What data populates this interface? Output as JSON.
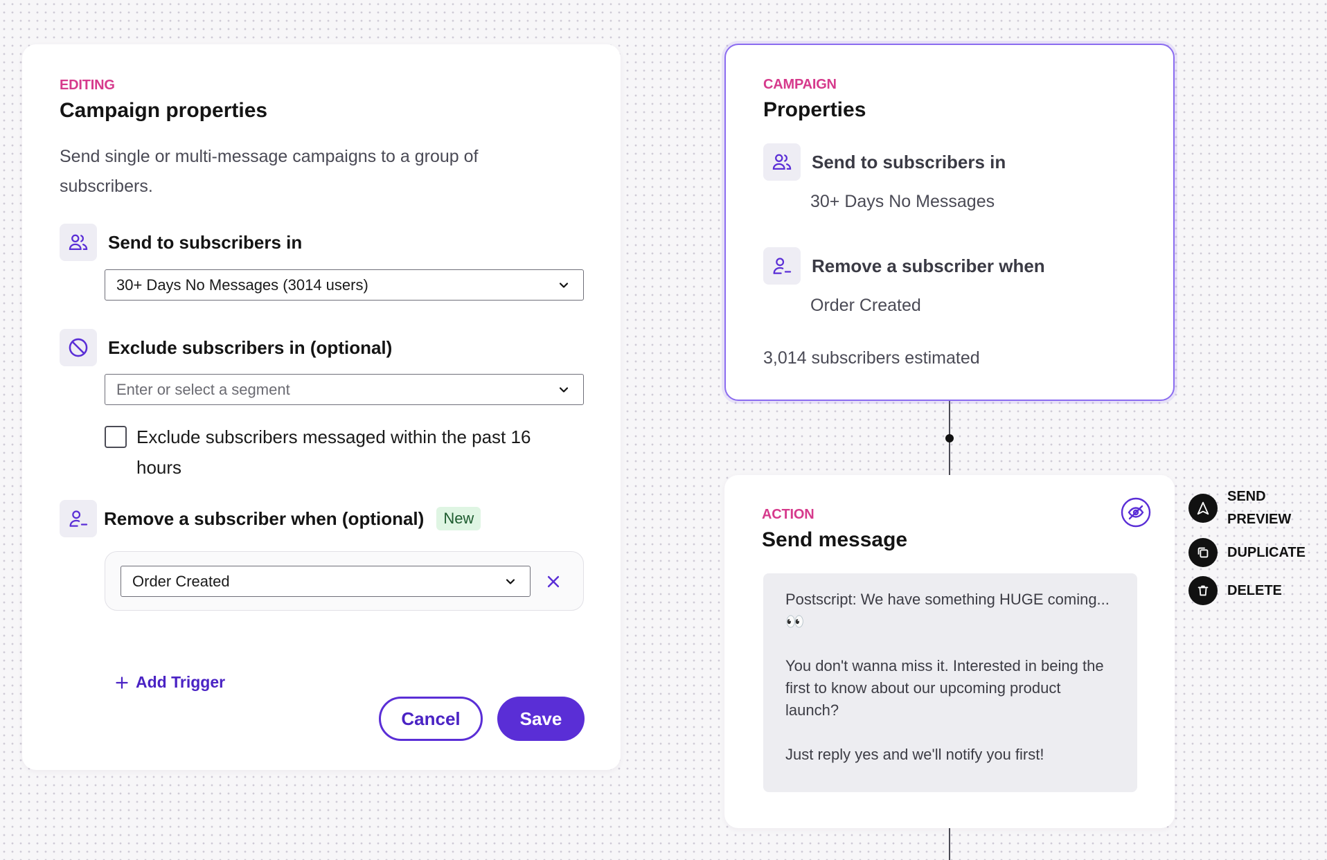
{
  "editing_panel": {
    "eyebrow": "EDITING",
    "title": "Campaign properties",
    "description": "Send single or multi-message campaigns to a group of subscribers.",
    "send_to": {
      "label": "Send to subscribers in",
      "selected": "30+ Days No Messages (3014 users)"
    },
    "exclude": {
      "label": "Exclude subscribers in (optional)",
      "placeholder": "Enter or select a segment"
    },
    "exclude_recent": {
      "label": "Exclude subscribers messaged within the past 16 hours",
      "checked": false
    },
    "remove_when": {
      "label": "Remove a subscriber when (optional)",
      "badge": "New",
      "trigger_selected": "Order Created",
      "add_trigger_label": "Add Trigger"
    },
    "cancel_label": "Cancel",
    "save_label": "Save"
  },
  "campaign_card": {
    "eyebrow": "CAMPAIGN",
    "title": "Properties",
    "send_to_label": "Send to subscribers in",
    "send_to_value": "30+ Days No Messages",
    "remove_label": "Remove a subscriber when",
    "remove_value": "Order Created",
    "estimate": "3,014 subscribers estimated"
  },
  "action_card": {
    "eyebrow": "ACTION",
    "title": "Send message",
    "message_paragraphs": [
      "Postscript: We have something HUGE coming...👀",
      "You don't wanna miss it. Interested in being the first to know about our upcoming product launch?",
      "Just reply yes and we'll notify you first!"
    ]
  },
  "side_actions": {
    "send_preview_line1": "SEND",
    "send_preview_line2": "PREVIEW",
    "duplicate": "DUPLICATE",
    "delete": "DELETE"
  },
  "colors": {
    "accent": "#5a2ed6",
    "eyebrow": "#d63a8c",
    "selected_border": "#8a6bf0",
    "new_badge_bg": "#dff5e3"
  },
  "icons": {
    "users": "users-icon",
    "ban": "ban-icon",
    "user_minus": "user-minus-icon",
    "chevron": "chevron-down-icon",
    "close": "close-icon",
    "plus": "plus-icon",
    "hidden": "eye-off-icon",
    "send": "send-icon",
    "duplicate": "duplicate-icon",
    "delete": "trash-icon"
  }
}
